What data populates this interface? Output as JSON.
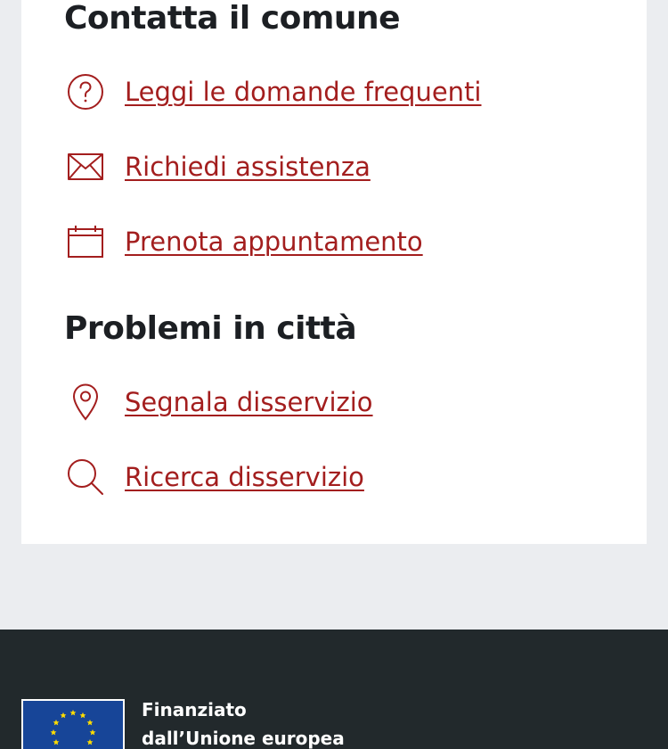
{
  "contact": {
    "title": "Contatta il comune",
    "links": [
      {
        "label": "Leggi le domande frequenti",
        "icon": "help-circle-icon"
      },
      {
        "label": "Richiedi assistenza",
        "icon": "mail-icon"
      },
      {
        "label": "Prenota appuntamento",
        "icon": "calendar-icon"
      }
    ]
  },
  "problems": {
    "title": "Problemi in città",
    "links": [
      {
        "label": "Segnala disservizio",
        "icon": "map-marker-icon"
      },
      {
        "label": "Ricerca disservizio",
        "icon": "search-icon"
      }
    ]
  },
  "footer": {
    "eu_funding_line1": "Finanziato",
    "eu_funding_line2": "dall’Unione europea",
    "eu_logo_icon": "eu-flag-icon"
  },
  "colors": {
    "link": "#a31e1e",
    "heading": "#1c1f23",
    "page_bg": "#ebedf0",
    "footer_bg": "#22292c",
    "eu_blue": "#174598",
    "eu_star": "#ffdd00"
  }
}
